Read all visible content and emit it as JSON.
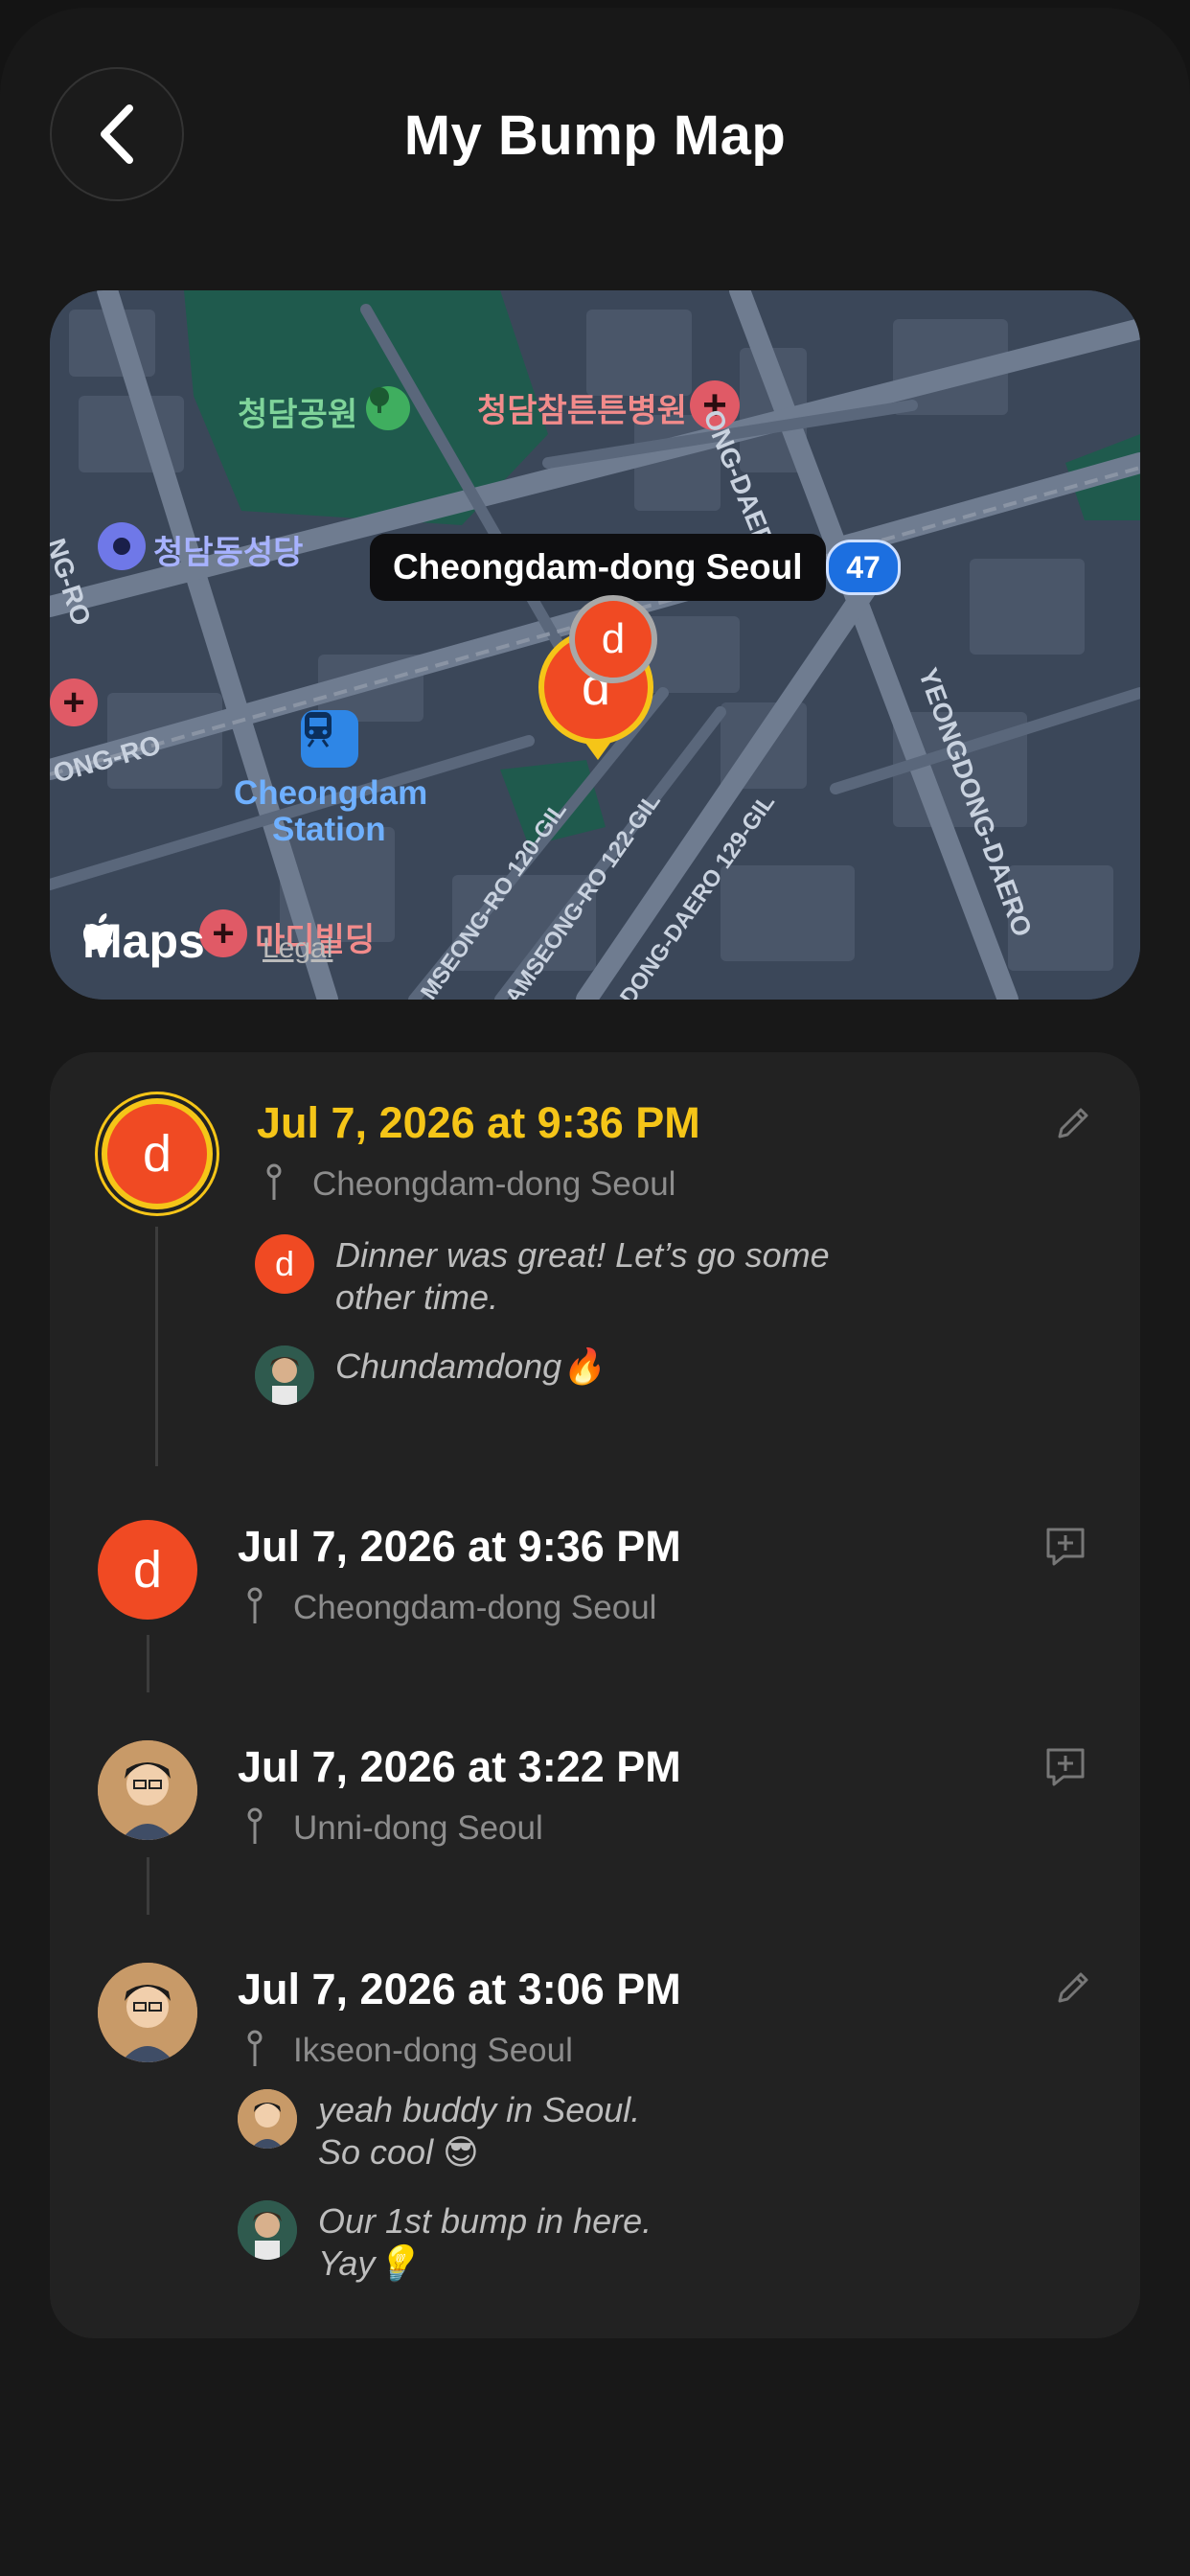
{
  "header": {
    "title": "My Bump Map",
    "back_icon": "chevron-left-icon"
  },
  "map": {
    "location_label": "Cheongdam-dong Seoul",
    "route_number": "47",
    "pin_letter": "d",
    "labels": {
      "park": "청담공원",
      "hospital": "청담참튼튼병원",
      "cathedral": "청담동성당",
      "station_line1": "Cheongdam",
      "station_line2": "Station",
      "building": "마디빌딩",
      "road_daero_top": "ONG-DAERO",
      "road_yeongdong": "YEONGDONG-DAERO",
      "road_ro_left": "NG-RO",
      "road_ro_left2": "ONG-RO",
      "road_120": "MSEONG-RO 120-GIL",
      "road_122": "AMSEONG-RO 122-GIL",
      "road_129": "DONG-DAERO 129-GIL"
    },
    "attribution": "Maps",
    "legal": "Legal"
  },
  "feed": [
    {
      "date": "Jul 7, 2026 at 9:36 PM",
      "place": "Cheongdam-dong Seoul",
      "avatar_letter": "d",
      "highlighted": true,
      "action_icon": "pencil-icon",
      "comments": [
        {
          "avatar_letter": "d",
          "text": "Dinner was great! Let’s go some\nother time."
        },
        {
          "avatar_letter": "",
          "text": "Chundamdong🔥"
        }
      ]
    },
    {
      "date": "Jul 7, 2026 at 9:36 PM",
      "place": "Cheongdam-dong Seoul",
      "avatar_letter": "d",
      "action_icon": "add-comment-icon"
    },
    {
      "date": "Jul 7, 2026 at 3:22 PM",
      "place": "Unni-dong Seoul",
      "avatar_letter": "",
      "action_icon": "add-comment-icon"
    },
    {
      "date": "Jul 7, 2026 at 3:06 PM",
      "place": "Ikseon-dong Seoul",
      "avatar_letter": "",
      "action_icon": "pencil-icon",
      "comments": [
        {
          "avatar_letter": "",
          "text": "yeah buddy in Seoul.\nSo cool 😎"
        },
        {
          "avatar_letter": "",
          "text": "Our 1st bump in here.\nYay💡"
        }
      ]
    }
  ],
  "colors": {
    "accent_yellow": "#f5c518",
    "avatar_orange": "#f04a23",
    "background": "#181818",
    "card": "#222222"
  }
}
